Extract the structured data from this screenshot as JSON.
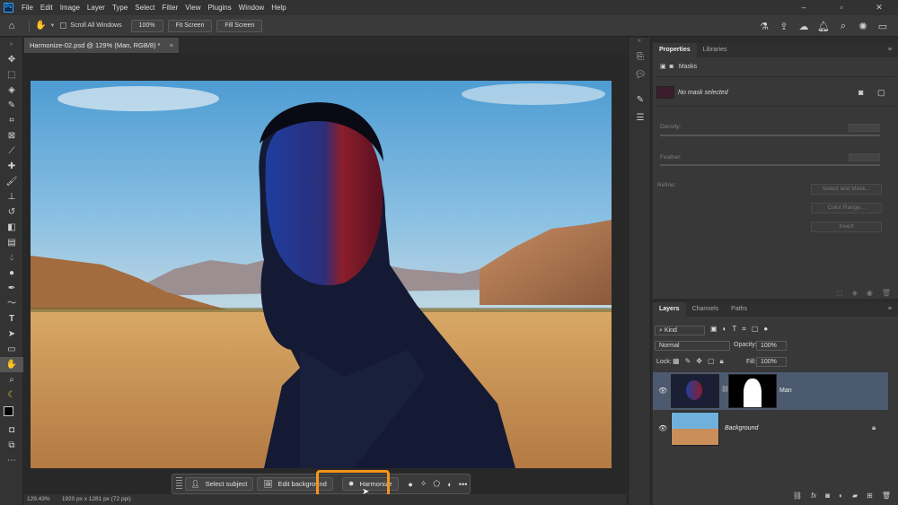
{
  "menubar": {
    "app_logo": "Ps",
    "items": [
      "File",
      "Edit",
      "Image",
      "Layer",
      "Type",
      "Select",
      "Filter",
      "View",
      "Plugins",
      "Window",
      "Help"
    ]
  },
  "options_bar": {
    "scroll_all_windows": "Scroll All Windows",
    "zoom_value": "100%",
    "fit_screen": "Fit Screen",
    "fill_screen": "Fill Screen"
  },
  "document": {
    "tab_title": "Harmonize-02.psd @ 129% (Man, RGB/8) *",
    "close": "×"
  },
  "status_bar": {
    "zoom": "129.43%",
    "dimensions": "1920 px x 1281 px (72 ppi)"
  },
  "contextual_taskbar": {
    "select_subject": "Select subject",
    "edit_background": "Edit background",
    "harmonize": "Harmonize",
    "more": "•••"
  },
  "properties_panel": {
    "tabs": [
      "Properties",
      "Libraries"
    ],
    "section": "Masks",
    "mask_status": "No mask selected",
    "density_label": "Density:",
    "feather_label": "Feather:",
    "refine_label": "Refine:",
    "select_and_mask": "Select and Mask...",
    "color_range": "Color Range...",
    "invert": "Invert"
  },
  "layers_panel": {
    "tabs": [
      "Layers",
      "Channels",
      "Paths"
    ],
    "filter_kind": "Kind",
    "blend_mode": "Normal",
    "opacity_label": "Opacity:",
    "opacity_value": "100%",
    "lock_label": "Lock:",
    "fill_label": "Fill:",
    "fill_value": "100%",
    "layers": [
      {
        "name": "Man",
        "selected": true
      },
      {
        "name": "Background",
        "selected": false
      }
    ]
  },
  "colors": {
    "accent_highlight": "#f7941d",
    "selected_layer": "#4c5a6f",
    "ps_blue": "#31a8ff"
  }
}
